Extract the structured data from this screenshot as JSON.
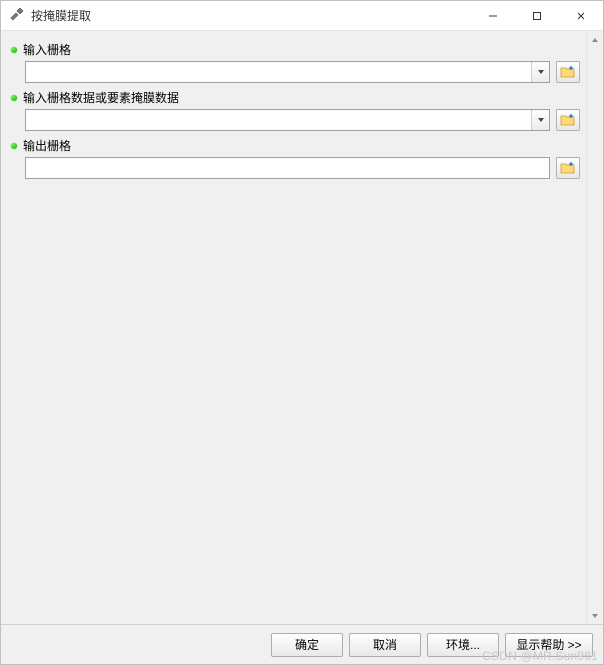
{
  "window": {
    "title": "按掩膜提取"
  },
  "fields": [
    {
      "label": "输入栅格",
      "value": "",
      "hasDropdown": true,
      "hasBrowse": true,
      "bulletColor": "#2ecc40"
    },
    {
      "label": "输入栅格数据或要素掩膜数据",
      "value": "",
      "hasDropdown": true,
      "hasBrowse": true,
      "bulletColor": "#2ecc40"
    },
    {
      "label": "输出栅格",
      "value": "",
      "hasDropdown": false,
      "hasBrowse": true,
      "bulletColor": "#2ecc40"
    }
  ],
  "footer": {
    "ok": "确定",
    "cancel": "取消",
    "env": "环境...",
    "help": "显示帮助 >>"
  },
  "watermark": "CSDN @MR.Sun961"
}
